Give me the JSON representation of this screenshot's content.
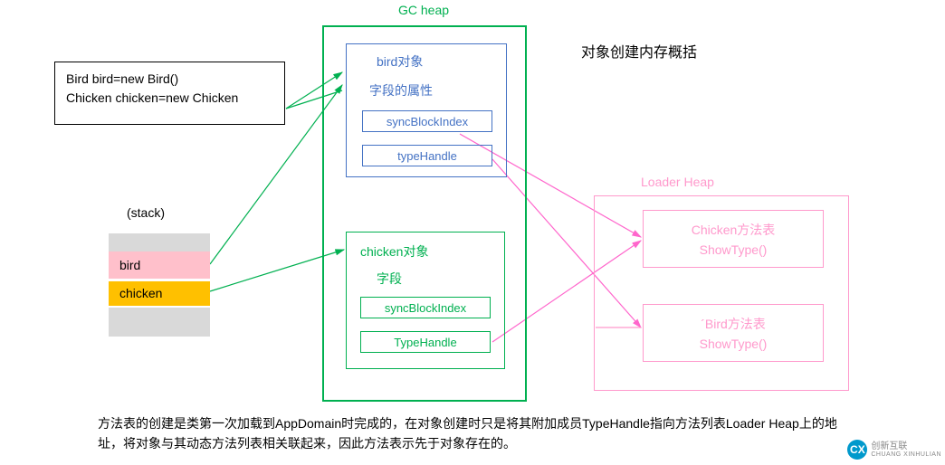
{
  "code": {
    "line1": "Bird bird=new Bird()",
    "line2": "Chicken chicken=new Chicken"
  },
  "stack": {
    "label": "(stack)",
    "bird": "bird",
    "chicken": "chicken"
  },
  "gc": {
    "label": "GC heap",
    "bird": {
      "title": "bird对象",
      "field": "字段的属性",
      "sync": "syncBlockIndex",
      "th": "typeHandle"
    },
    "chicken": {
      "title": "chicken对象",
      "field": "字段",
      "sync": "syncBlockIndex",
      "th": "TypeHandle"
    }
  },
  "title": "对象创建内存概括",
  "loader": {
    "label": "Loader Heap",
    "chicken": {
      "name": "Chicken方法表",
      "show": "ShowType()"
    },
    "bird": {
      "name": "´Bird方法表",
      "show": "ShowType()"
    }
  },
  "bottom": "方法表的创建是类第一次加载到AppDomain时完成的，在对象创建时只是将其附加成员TypeHandle指向方法列表Loader Heap上的地址，将对象与其动态方法列表相关联起来，因此方法表示先于对象存在的。",
  "watermark": {
    "brand": "创新互联",
    "sub": "CHUANG XINHULIAN"
  },
  "colors": {
    "green": "#00b050",
    "blue": "#4472c4",
    "pink": "#ff66cc",
    "loaderPink": "#ff99cc"
  },
  "chart_data": {
    "type": "diagram",
    "title": "对象创建内存概括",
    "nodes": [
      {
        "id": "code",
        "area": "source",
        "lines": [
          "Bird bird=new Bird()",
          "Chicken chicken=new Chicken"
        ]
      },
      {
        "id": "stack",
        "area": "stack",
        "slots": [
          "bird",
          "chicken"
        ]
      },
      {
        "id": "gc_bird",
        "area": "GC heap",
        "label": "bird对象",
        "fields": [
          "字段的属性",
          "syncBlockIndex",
          "typeHandle"
        ]
      },
      {
        "id": "gc_chicken",
        "area": "GC heap",
        "label": "chicken对象",
        "fields": [
          "字段",
          "syncBlockIndex",
          "TypeHandle"
        ]
      },
      {
        "id": "loader_chicken",
        "area": "Loader Heap",
        "label": "Chicken方法表",
        "members": [
          "ShowType()"
        ]
      },
      {
        "id": "loader_bird",
        "area": "Loader Heap",
        "label": "Bird方法表",
        "members": [
          "ShowType()"
        ]
      }
    ],
    "edges": [
      {
        "from": "code",
        "to": "gc_bird",
        "color": "green"
      },
      {
        "from": "stack.bird",
        "to": "gc_bird",
        "color": "green"
      },
      {
        "from": "stack.chicken",
        "to": "gc_chicken",
        "color": "green"
      },
      {
        "from": "gc_bird.typeHandle",
        "to": "loader_bird",
        "color": "pink"
      },
      {
        "from": "gc_chicken.TypeHandle",
        "to": "loader_chicken",
        "color": "pink"
      },
      {
        "from": "gc_bird.syncBlockIndex",
        "to": "loader_chicken",
        "color": "pink",
        "style": "crossing"
      }
    ]
  }
}
